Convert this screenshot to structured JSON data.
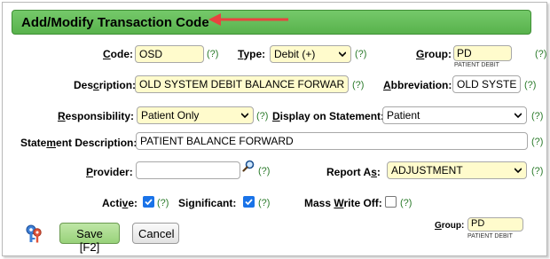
{
  "header": {
    "title": "Add/Modify Transaction Code"
  },
  "help_marker": "(?)",
  "form": {
    "code": {
      "label_pre": "",
      "label_u": "C",
      "label_post": "ode:",
      "value": "OSD"
    },
    "type": {
      "label_pre": "",
      "label_u": "T",
      "label_post": "ype:",
      "value": "Debit (+)"
    },
    "group": {
      "label_pre": "",
      "label_u": "G",
      "label_post": "roup:",
      "value": "PD",
      "sublabel": "PATIENT DEBIT"
    },
    "description": {
      "label_pre": "Des",
      "label_u": "c",
      "label_post": "ription:",
      "value": "OLD SYSTEM DEBIT BALANCE FORWAR"
    },
    "abbreviation": {
      "label_pre": "",
      "label_u": "A",
      "label_post": "bbreviation:",
      "value": "OLD SYSTE"
    },
    "responsibility": {
      "label_pre": "",
      "label_u": "R",
      "label_post": "esponsibility:",
      "value": "Patient Only"
    },
    "display_on_statement": {
      "label_pre": "",
      "label_u": "D",
      "label_post": "isplay on Statement:",
      "value": "Patient"
    },
    "statement_description": {
      "label_pre": "State",
      "label_u": "m",
      "label_post": "ent Description:",
      "value": "PATIENT BALANCE FORWARD"
    },
    "provider": {
      "label_pre": "",
      "label_u": "P",
      "label_post": "rovider:",
      "value": ""
    },
    "report_as": {
      "label_pre": "Report A",
      "label_u": "s",
      "label_post": ":",
      "value": "ADJUSTMENT"
    },
    "active": {
      "label_pre": "Acti",
      "label_u": "v",
      "label_post": "e:",
      "checked": true
    },
    "significant": {
      "label_pre": "Si",
      "label_u": "g",
      "label_post": "nificant:",
      "checked": true
    },
    "mass_write_off": {
      "label_pre": "Mass ",
      "label_u": "W",
      "label_post": "rite Off:",
      "checked": false
    },
    "group_bottom": {
      "label_pre": "",
      "label_u": "G",
      "label_post": "roup:",
      "value": "PD",
      "sublabel": "PATIENT DEBIT"
    }
  },
  "buttons": {
    "save": "Save [F2]",
    "cancel": "Cancel"
  },
  "colors": {
    "title_bar": "#5db552",
    "arrow": "#e8433f",
    "field_highlight": "#fffbcc",
    "checkbox": "#1a73e8",
    "help": "#2a7a2a"
  }
}
